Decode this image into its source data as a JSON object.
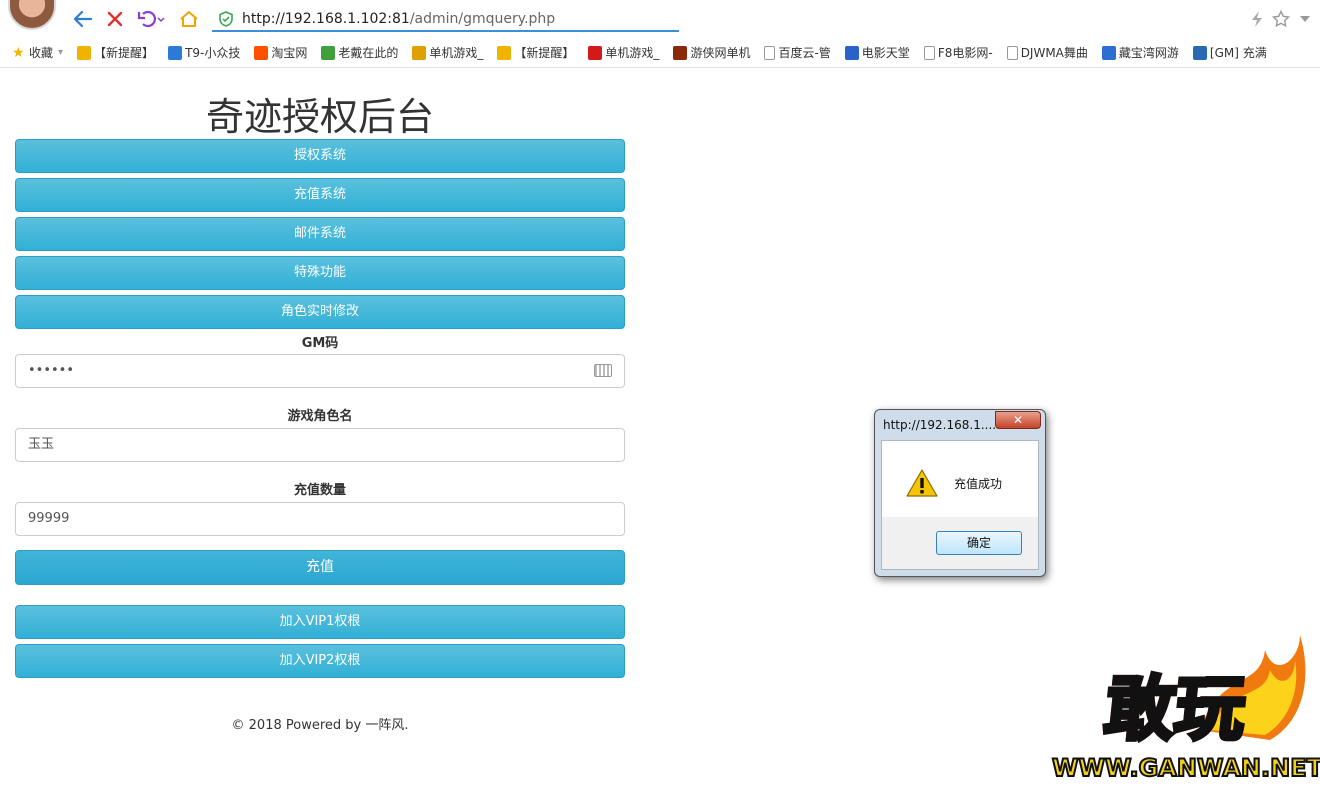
{
  "browser": {
    "url_host": "http://192.168.1.102:81",
    "url_path": "/admin/gmquery.php"
  },
  "bookmarks": [
    {
      "label": "收藏",
      "icon": "star-icon",
      "color": "#f5b400"
    },
    {
      "label": "【新提醒】",
      "icon": "trophy-icon",
      "color": "#f0b400"
    },
    {
      "label": "T9-小众技",
      "icon": "t9-icon",
      "color": "#2b7bd6"
    },
    {
      "label": "淘宝网",
      "icon": "taobao-icon",
      "color": "#ff5000"
    },
    {
      "label": "老戴在此的",
      "icon": "iqiyi-icon",
      "color": "#3ea03b"
    },
    {
      "label": "单机游戏_",
      "icon": "game-icon",
      "color": "#e0a000"
    },
    {
      "label": "【新提醒】",
      "icon": "trophy-icon",
      "color": "#f0b400"
    },
    {
      "label": "单机游戏_",
      "icon": "g-icon",
      "color": "#d21a1a"
    },
    {
      "label": "游侠网单机",
      "icon": "ali213-icon",
      "color": "#8a2a0a"
    },
    {
      "label": "百度云-管",
      "icon": "page-icon",
      "color": "#999999"
    },
    {
      "label": "电影天堂",
      "icon": "film-icon",
      "color": "#2a62c9"
    },
    {
      "label": "F8电影网-",
      "icon": "page-icon",
      "color": "#999999"
    },
    {
      "label": "DJWMA舞曲",
      "icon": "page-icon",
      "color": "#999999"
    },
    {
      "label": "藏宝湾网游",
      "icon": "globe-icon",
      "color": "#2c6fd1"
    },
    {
      "label": "[GM] 充满",
      "icon": "gm-icon",
      "color": "#2a6ab5"
    }
  ],
  "page": {
    "title": "奇迹授权后台",
    "menu": [
      "授权系统",
      "充值系统",
      "邮件系统",
      "特殊功能",
      "角色实时修改"
    ],
    "gm_label": "GM码",
    "gm_value": "••••••",
    "role_label": "游戏角色名",
    "role_value": "玉玉",
    "amount_label": "充值数量",
    "amount_value": "99999",
    "recharge_button": "充值",
    "vip1_button": "加入VIP1权根",
    "vip2_button": "加入VIP2权根",
    "footer": "© 2018 Powered by 一阵风."
  },
  "dialog": {
    "title": "http://192.168.1....",
    "close": "✕",
    "message": "充值成功",
    "ok": "确定"
  },
  "watermark": {
    "brand": "敢玩",
    "url": "WWW.GANWAN.NET"
  },
  "colors": {
    "accent": "#5bc0de",
    "url_underline": "#3b8fd6"
  }
}
